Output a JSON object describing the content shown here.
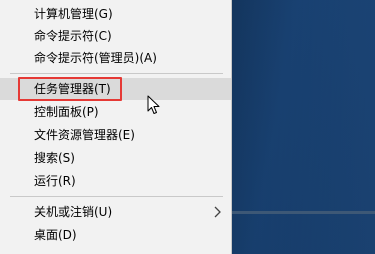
{
  "menu": {
    "items": [
      {
        "label": "计算机管理(G)"
      },
      {
        "label": "命令提示符(C)"
      },
      {
        "label": "命令提示符(管理员)(A)"
      },
      {
        "label": "任务管理器(T)"
      },
      {
        "label": "控制面板(P)"
      },
      {
        "label": "文件资源管理器(E)"
      },
      {
        "label": "搜索(S)"
      },
      {
        "label": "运行(R)"
      },
      {
        "label": "关机或注销(U)"
      },
      {
        "label": "桌面(D)"
      }
    ],
    "submenu_icon": "chevron-right-icon"
  },
  "annotation": {
    "highlight_color": "#e53935"
  },
  "cursor": {
    "icon": "mouse-pointer-icon"
  }
}
